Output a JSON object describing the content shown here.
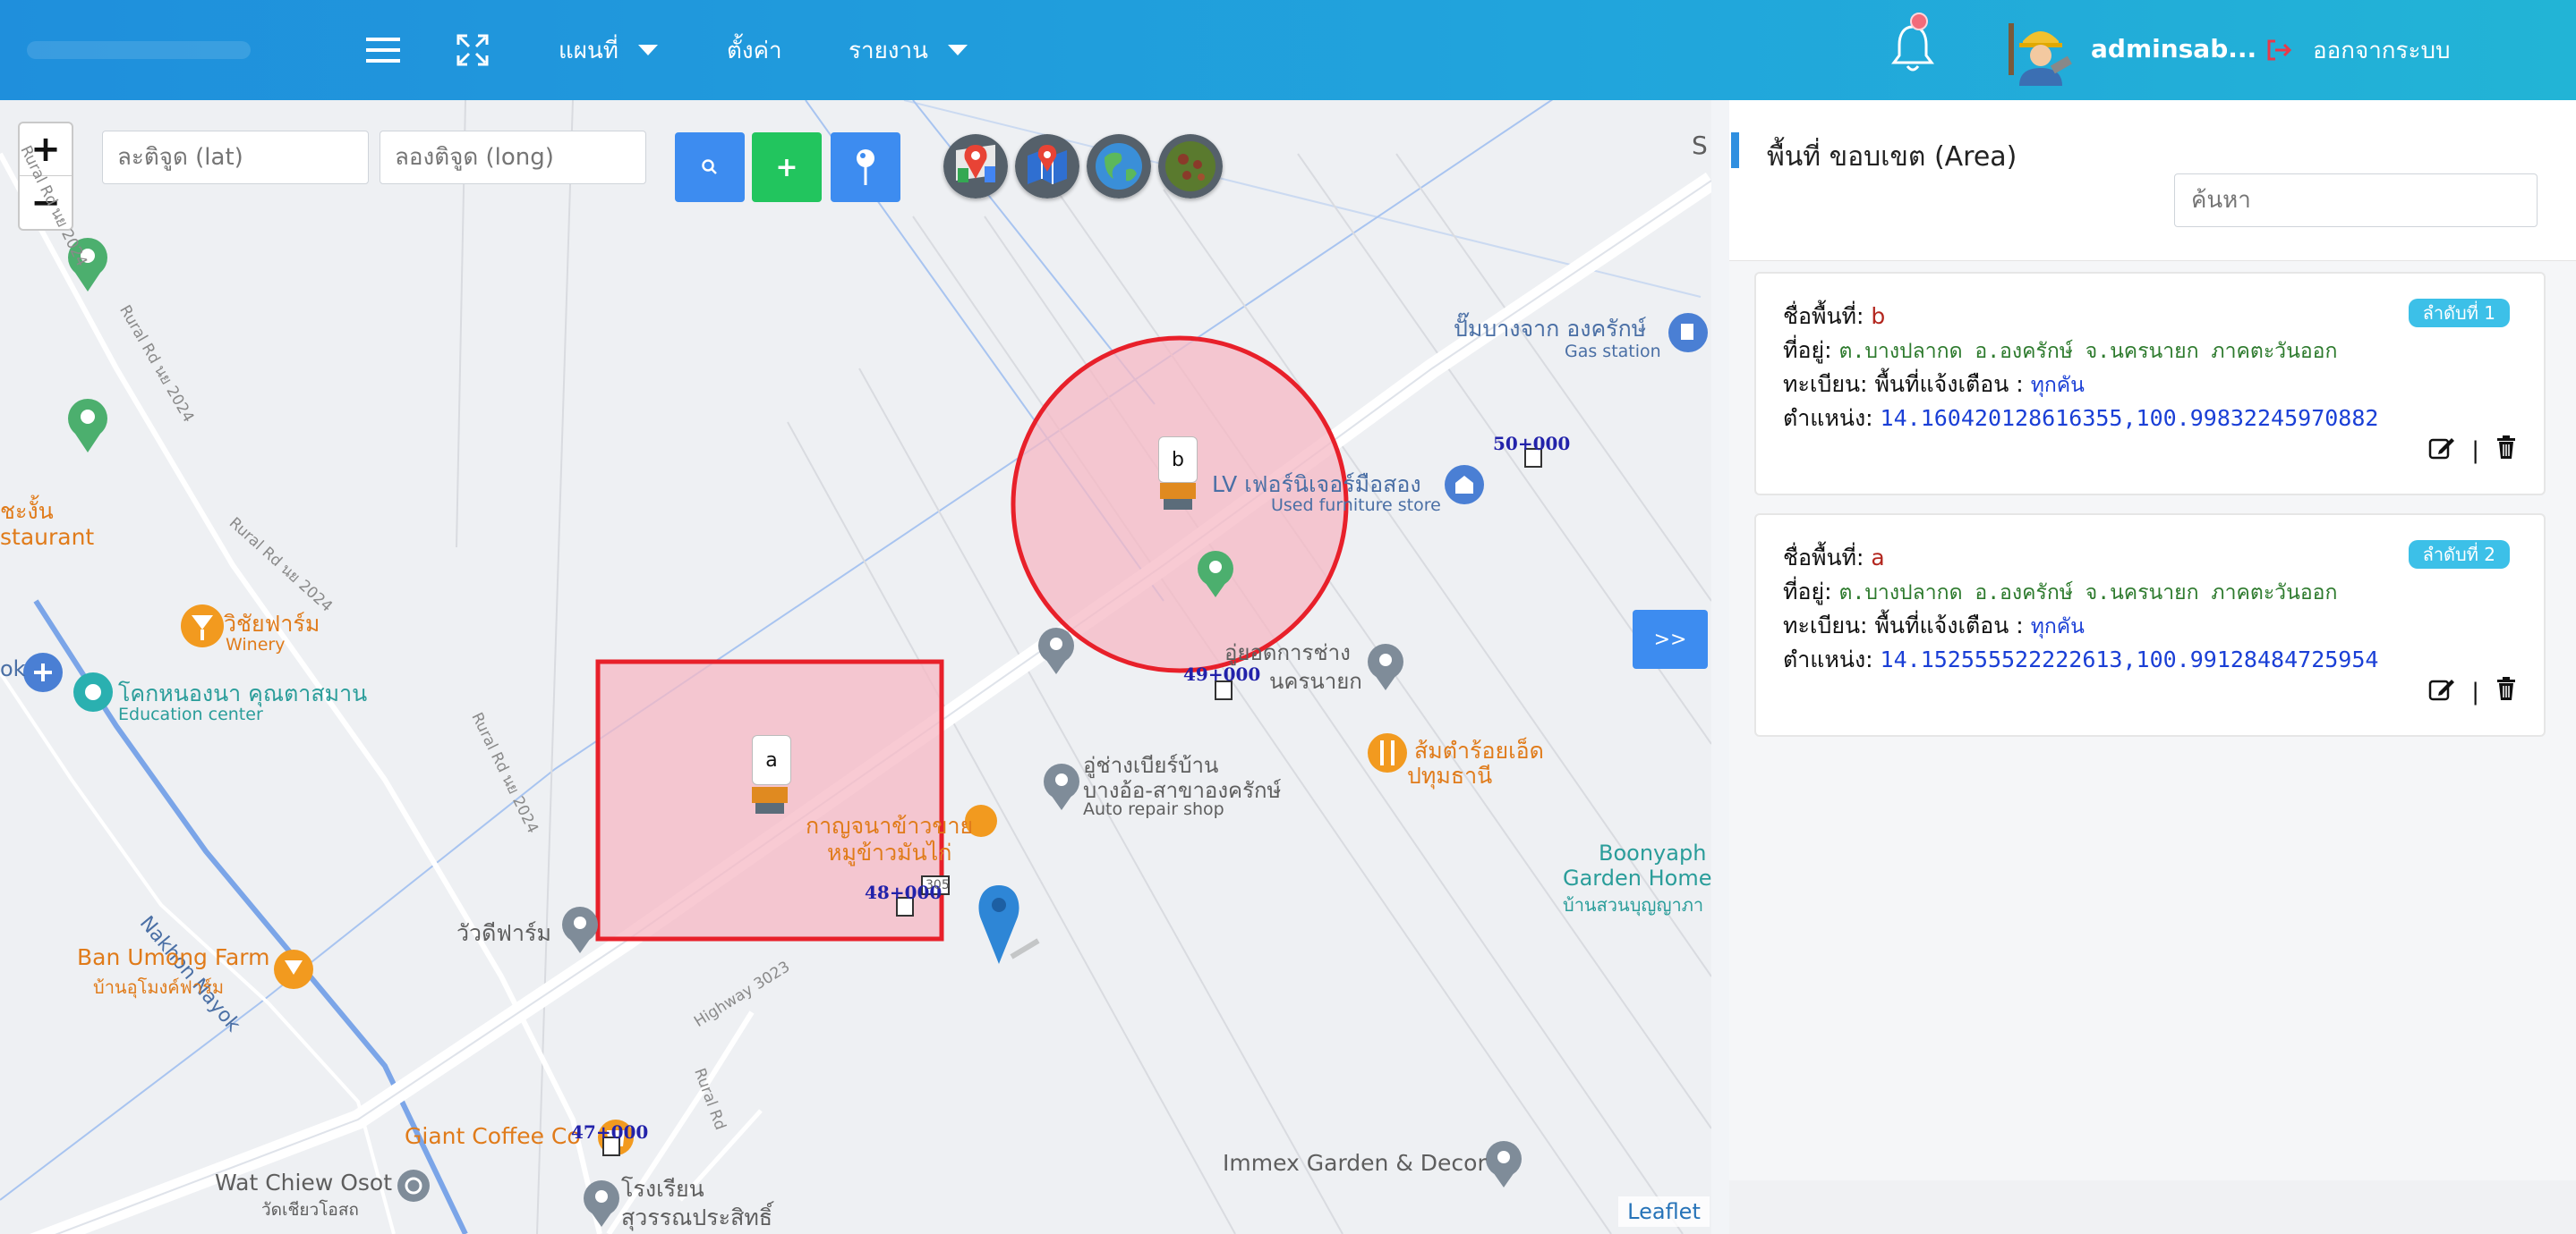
{
  "navbar": {
    "menu_map": "แผนที่",
    "menu_settings": "ตั้งค่า",
    "menu_report": "รายงาน",
    "username": "adminsab...",
    "logout": "ออกจากระบบ",
    "icons": [
      "hamburger-icon",
      "fullscreen-icon",
      "bell-icon",
      "avatar-engineer",
      "logout-icon"
    ]
  },
  "map": {
    "zoom_in": "+",
    "zoom_out": "−",
    "lat_placeholder": "ละติจูด (lat)",
    "long_placeholder": "ลองติจูด (long)",
    "buttons": [
      {
        "name": "search-button",
        "icon": "search-icon",
        "color": "#3d8cf0"
      },
      {
        "name": "add-button",
        "label": "+",
        "color": "#22c55e"
      },
      {
        "name": "pin-button",
        "icon": "location-pin-icon",
        "color": "#3d8cf0"
      }
    ],
    "layers": [
      "google-maps-layer",
      "mapbox-layer",
      "earth-layer",
      "satellite-layer"
    ],
    "labels": {
      "gas_station_name": "ปั๊มบางจาก องครักษ์",
      "gas_station": "Gas station",
      "furniture_name": "LV เฟอร์นิเจอร์มือสอง",
      "furniture": "Used furniture store",
      "garage_name": "อู่ยอดการช่าง",
      "garage_sub": "นครนายก",
      "repair_name1": "อู่ช่างเบียร์บ้าน",
      "repair_name2": "บางอ้อ-สาขาองครักษ์",
      "repair": "Auto repair shop",
      "somtam1": "ส้มตำร้อยเอ็ด",
      "somtam2": "ปทุมธานี",
      "boonyaph": "Boonyaph",
      "garden_home": "Garden Home",
      "garden_th": "บ้านสวนบุญญาภา",
      "winery_name": "วิชัยฟาร์ม",
      "winery": "Winery",
      "khok_name": "โคกหนองนา คุณตาสมาน",
      "khok": "Education center",
      "restaurant_th": "ชะงั้น",
      "restaurant": "staurant",
      "ok": "ok",
      "nakhon_nayok": "Nakhon Nayok",
      "ban_umong": "Ban Umong Farm",
      "ban_umong_th": "บ้านอุโมงค์ฟาร์ม",
      "wat_farm": "วัวดีฟาร์ม",
      "kanjana1": "กาญจนาข้าวขาย",
      "kanjana2": "หมูข้าวมันไก่",
      "giant_coffee": "Giant Coffee Co",
      "wat_chiew": "Wat Chiew Osot",
      "wat_chiew_th": "วัดเชียวโอสถ",
      "school1": "โรงเรียน",
      "school2": "สุวรรณประสิทธิ์",
      "immex": "Immex Garden & Decor",
      "road_2024a": "Rural Rd นย 2024",
      "road_2024b": "Rural Rd นย 2024",
      "road_2024c": "Rural Rd นย 2024",
      "road_2024d": "Rural Rd นย 2024",
      "highway": "Highway 3023",
      "rural_rd": "Rural Rd",
      "s_edge": "S",
      "km_50": "50+000",
      "km_49": "49+000",
      "km_48": "48+000",
      "km_47": "47+000",
      "sign_305": "305"
    },
    "area_tags": {
      "b": "b",
      "a": "a"
    },
    "expand": ">>",
    "attribution": "Leaflet"
  },
  "panel": {
    "title": "พื้นที่ ขอบเขต (Area)",
    "search_placeholder": "ค้นหา",
    "items": [
      {
        "name_label": "ชื่อพื้นที่:",
        "name": "b",
        "badge": "ลำดับที่ 1",
        "address_label": "ที่อยู่:",
        "address": "ต.บางปลากด อ.องครักษ์ จ.นครนายก ภาคตะวันออก",
        "reg_label": "ทะเบียน:",
        "reg_type": "พื้นที่แจ้งเตือน",
        "reg_sep": ":",
        "reg_value": "ทุกคัน",
        "pos_label": "ตำแหน่ง:",
        "position": "14.160420128616355,100.99832245970882",
        "sep": "|"
      },
      {
        "name_label": "ชื่อพื้นที่:",
        "name": "a",
        "badge": "ลำดับที่ 2",
        "address_label": "ที่อยู่:",
        "address": "ต.บางปลากด อ.องครักษ์ จ.นครนายก ภาคตะวันออก",
        "reg_label": "ทะเบียน:",
        "reg_type": "พื้นที่แจ้งเตือน",
        "reg_sep": ":",
        "reg_value": "ทุกคัน",
        "pos_label": "ตำแหน่ง:",
        "position": "14.152555522222613,100.99128484725954",
        "sep": "|"
      }
    ]
  },
  "colors": {
    "navbar": "#21a4dc",
    "accent": "#3d8cf0",
    "area_fill": "#f5b8c4",
    "area_stroke": "#e8202a",
    "badge": "#3cc0e8"
  }
}
